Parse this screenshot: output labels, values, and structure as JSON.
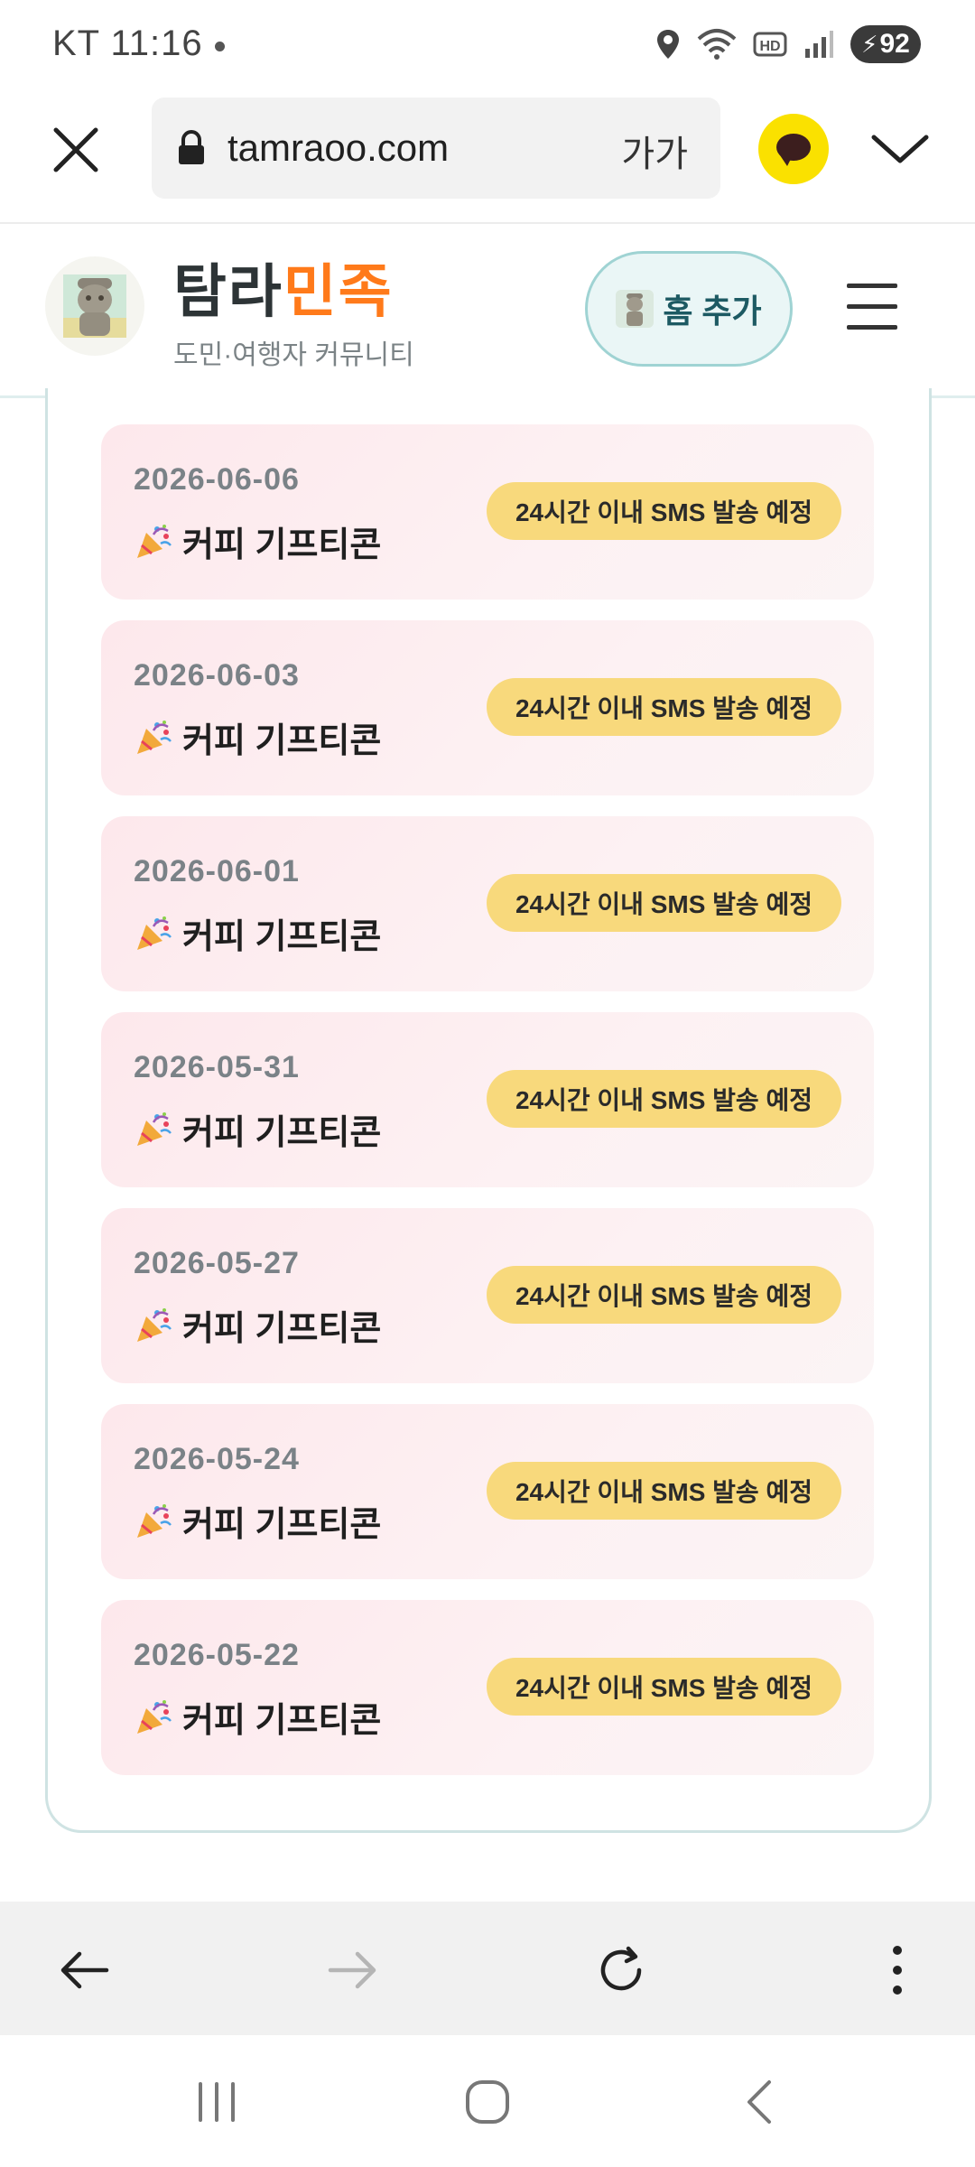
{
  "status_bar": {
    "carrier": "KT",
    "time": "11:16",
    "battery": "92",
    "icons": [
      "location-icon",
      "wifi-icon",
      "hd-icon",
      "signal-icon",
      "battery-charging-icon"
    ]
  },
  "browser": {
    "url": "tamraoo.com",
    "text_size_label": "가가",
    "icons": [
      "close-icon",
      "lock-icon",
      "kakaotalk-icon",
      "chevron-down-icon"
    ]
  },
  "site": {
    "brand_part1": "탐라",
    "brand_part2": "민족",
    "tagline": "도민·여행자 커뮤니티",
    "home_add_label": "홈 추가",
    "accent": "#ff7a1a",
    "badge_color": "#f8d97c"
  },
  "notifications": [
    {
      "date": "2026-06-06",
      "title": "커피 기프티콘",
      "badge": "24시간 이내 SMS 발송 예정"
    },
    {
      "date": "2026-06-03",
      "title": "커피 기프티콘",
      "badge": "24시간 이내 SMS 발송 예정"
    },
    {
      "date": "2026-06-01",
      "title": "커피 기프티콘",
      "badge": "24시간 이내 SMS 발송 예정"
    },
    {
      "date": "2026-05-31",
      "title": "커피 기프티콘",
      "badge": "24시간 이내 SMS 발송 예정"
    },
    {
      "date": "2026-05-27",
      "title": "커피 기프티콘",
      "badge": "24시간 이내 SMS 발송 예정"
    },
    {
      "date": "2026-05-24",
      "title": "커피 기프티콘",
      "badge": "24시간 이내 SMS 발송 예정"
    },
    {
      "date": "2026-05-22",
      "title": "커피 기프티콘",
      "badge": "24시간 이내 SMS 발송 예정"
    }
  ],
  "toolbar_icons": [
    "back-arrow-icon",
    "forward-arrow-icon",
    "reload-icon",
    "more-vert-icon"
  ],
  "nav_icons": [
    "recent-apps-icon",
    "home-icon",
    "nav-back-icon"
  ]
}
